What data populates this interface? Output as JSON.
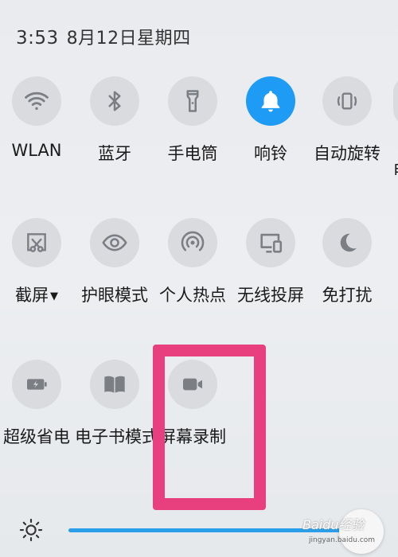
{
  "status_bar": {
    "time": "3:53",
    "date": "8月12日星期四"
  },
  "quick_settings": {
    "row1": [
      {
        "label": "WLAN",
        "icon": "wifi-icon"
      },
      {
        "label": "蓝牙",
        "icon": "bluetooth-icon"
      },
      {
        "label": "手电筒",
        "icon": "flashlight-icon"
      },
      {
        "label": "响铃",
        "icon": "bell-icon",
        "active": true
      },
      {
        "label": "自动旋转",
        "icon": "rotate-icon"
      }
    ],
    "row2": [
      {
        "label": "截屏",
        "icon": "screenshot-icon",
        "caret": "▼"
      },
      {
        "label": "护眼模式",
        "icon": "eye-icon"
      },
      {
        "label": "个人热点",
        "icon": "hotspot-icon"
      },
      {
        "label": "无线投屏",
        "icon": "cast-icon"
      },
      {
        "label": "免打扰",
        "icon": "moon-icon"
      }
    ],
    "row3": [
      {
        "label": "超级省电",
        "icon": "battery-saver-icon"
      },
      {
        "label": "电子书模式",
        "icon": "book-icon"
      },
      {
        "label": "屏幕录制",
        "icon": "video-camera-icon"
      }
    ],
    "partial_tile_label": "自"
  },
  "colors": {
    "accent": "#1e9bf5",
    "tile_bg": "#d9dbdf",
    "highlight": "#e8407e",
    "slider": "#2a9ee8"
  },
  "watermark": {
    "text": "Baidu经验",
    "sub": "jingyan.baidu.com"
  }
}
